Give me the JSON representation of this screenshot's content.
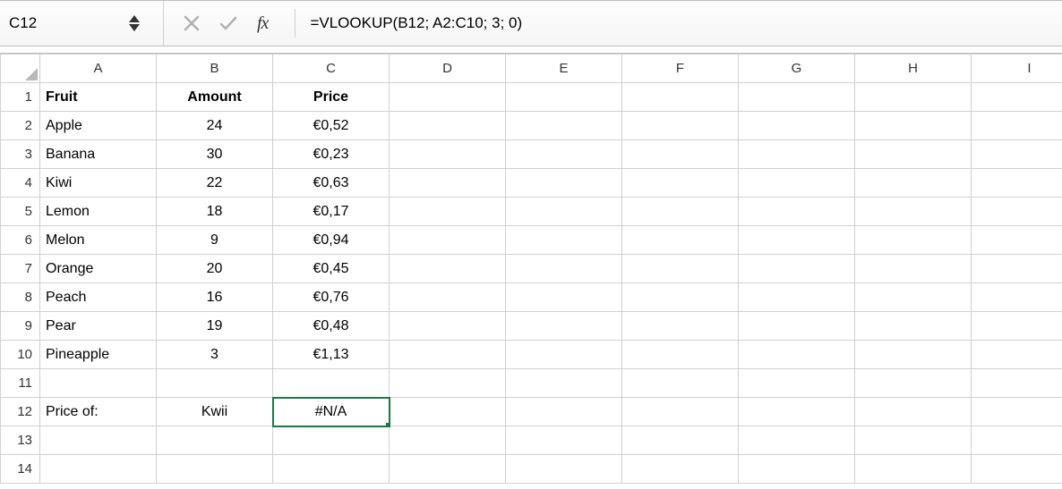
{
  "nameBox": "C12",
  "formula": "=VLOOKUP(B12; A2:C10; 3; 0)",
  "columns": [
    "A",
    "B",
    "C",
    "D",
    "E",
    "F",
    "G",
    "H",
    "I"
  ],
  "rows": [
    {
      "n": "1",
      "A": "Fruit",
      "B": "Amount",
      "C": "Price",
      "boldA": true,
      "boldB": true,
      "boldC": true
    },
    {
      "n": "2",
      "A": "Apple",
      "B": "24",
      "C": "€0,52"
    },
    {
      "n": "3",
      "A": "Banana",
      "B": "30",
      "C": "€0,23"
    },
    {
      "n": "4",
      "A": "Kiwi",
      "B": "22",
      "C": "€0,63"
    },
    {
      "n": "5",
      "A": "Lemon",
      "B": "18",
      "C": "€0,17"
    },
    {
      "n": "6",
      "A": "Melon",
      "B": "9",
      "C": "€0,94"
    },
    {
      "n": "7",
      "A": "Orange",
      "B": "20",
      "C": "€0,45"
    },
    {
      "n": "8",
      "A": "Peach",
      "B": "16",
      "C": "€0,76"
    },
    {
      "n": "9",
      "A": "Pear",
      "B": "19",
      "C": "€0,48"
    },
    {
      "n": "10",
      "A": "Pineapple",
      "B": "3",
      "C": "€1,13"
    },
    {
      "n": "11",
      "A": "",
      "B": "",
      "C": ""
    },
    {
      "n": "12",
      "A": "Price of:",
      "B": "Kwii",
      "C": "#N/A",
      "selectedC": true
    },
    {
      "n": "13",
      "A": "",
      "B": "",
      "C": ""
    },
    {
      "n": "14",
      "A": "",
      "B": "",
      "C": ""
    }
  ]
}
